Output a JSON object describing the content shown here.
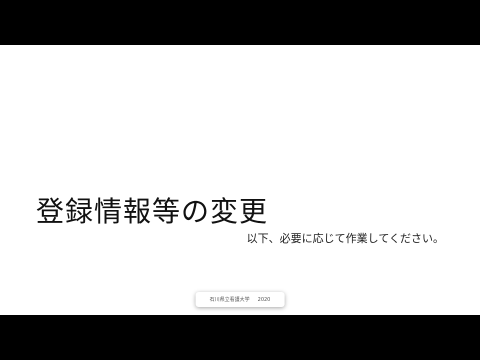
{
  "slide": {
    "title": "登録情報等の変更",
    "subtitle": "以下、必要に応じて作業してください。",
    "footer": {
      "institution": "石川県立看護大学",
      "year": "2020"
    }
  },
  "colors": {
    "background": "#000000",
    "slide_background": "#ffffff",
    "title_text": "#111111"
  }
}
